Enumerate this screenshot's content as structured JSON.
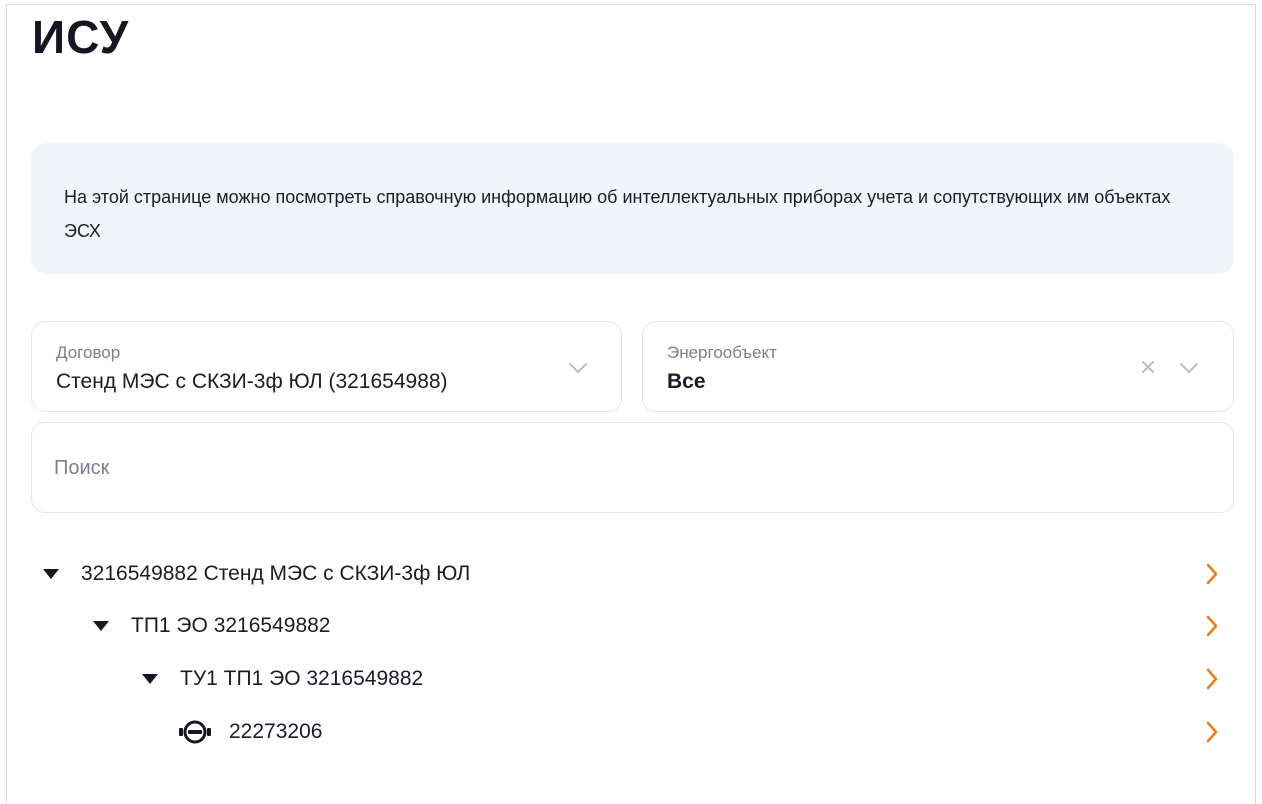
{
  "page": {
    "title": "ИСУ"
  },
  "info": {
    "text": "На этой странице можно посмотреть справочную информацию об интеллектуальных приборах учета и сопутствующих им объектах ЭСХ"
  },
  "filters": {
    "contract": {
      "label": "Договор",
      "value": "Стенд МЭС с СКЗИ-3ф ЮЛ (321654988)"
    },
    "energy_object": {
      "label": "Энергообъект",
      "value": "Все"
    },
    "search": {
      "placeholder": "Поиск",
      "value": ""
    }
  },
  "tree": {
    "items": [
      {
        "label": "3216549882 Стенд МЭС с СКЗИ-3ф ЮЛ",
        "level": 0,
        "expanded": true,
        "icon": "caret-down-icon"
      },
      {
        "label": "ТП1 ЭО 3216549882",
        "level": 1,
        "expanded": true,
        "icon": "caret-down-icon"
      },
      {
        "label": "ТУ1 ТП1 ЭО 3216549882",
        "level": 2,
        "expanded": true,
        "icon": "caret-down-icon"
      },
      {
        "label": "22273206",
        "level": 3,
        "icon": "meter-icon"
      }
    ]
  },
  "colors": {
    "accent": "#f07d1a",
    "info_bg": "#f1f4fa",
    "border": "#e3e6ec",
    "text": "#1c1c28",
    "muted": "#7a7f8c"
  }
}
